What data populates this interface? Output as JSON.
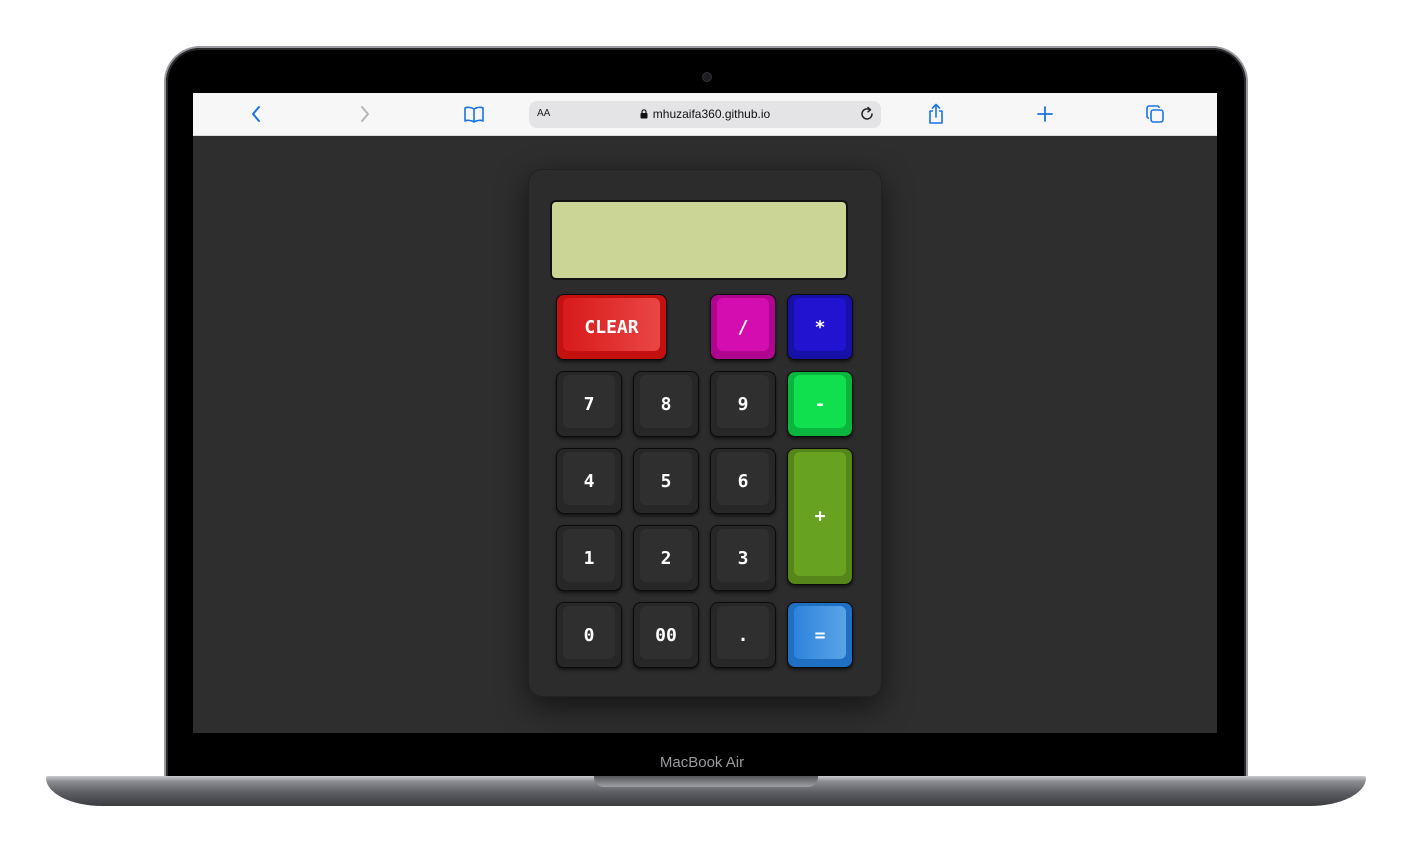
{
  "device": {
    "label": "MacBook Air"
  },
  "browser": {
    "text_size_label": "AA",
    "url": "mhuzaifa360.github.io",
    "icons": [
      "back-icon",
      "forward-icon",
      "bookmarks-icon",
      "lock-icon",
      "reload-icon",
      "share-icon",
      "new-tab-icon",
      "tabs-icon"
    ]
  },
  "calculator": {
    "display_value": "",
    "display_color": "#cbd595",
    "keys": {
      "clear": "CLEAR",
      "divide": "/",
      "multiply": "*",
      "subtract": "-",
      "add": "+",
      "equals": "=",
      "seven": "7",
      "eight": "8",
      "nine": "9",
      "four": "4",
      "five": "5",
      "six": "6",
      "one": "1",
      "two": "2",
      "three": "3",
      "zero": "0",
      "double_zero": "00",
      "decimal": "."
    },
    "colors": {
      "clear": "#c51010",
      "divide": "#b0058f",
      "multiply": "#1610a6",
      "subtract": "#0ab53e",
      "add": "#56861a",
      "equals": "#1f6fc2",
      "number": "#272727"
    }
  }
}
